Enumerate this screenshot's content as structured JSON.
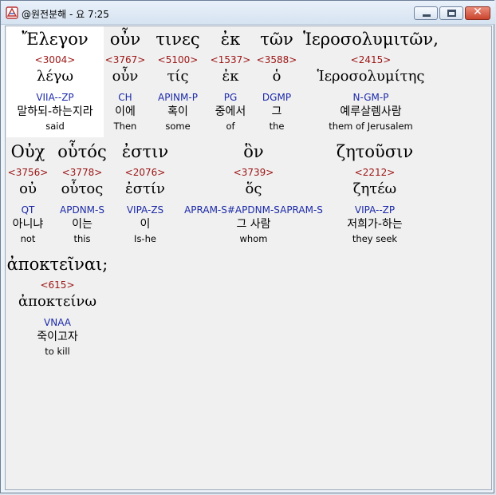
{
  "window": {
    "title": "@원전분해 - 요 7:25",
    "icon": "app-logo-icon"
  },
  "controls": {
    "minimize": "minimize-icon",
    "maximize": "maximize-icon",
    "close": "close-icon",
    "close_glyph": "✕"
  },
  "colors": {
    "number": "#9b1414",
    "parse": "#1c2aa8",
    "highlight": "#ffffff"
  },
  "rows": [
    [
      {
        "greek": "Ἔλεγον",
        "num": "<3004>",
        "lemma": "λέγω",
        "parse": "VIIA--ZP",
        "ko": "말하되-하는지라",
        "en": "said"
      },
      {
        "greek": "οὖν",
        "num": "<3767>",
        "lemma": "οὖν",
        "parse": "CH",
        "ko": "이에",
        "en": "Then"
      },
      {
        "greek": "τινες",
        "num": "<5100>",
        "lemma": "τίς",
        "parse": "APINM-P",
        "ko": "혹이",
        "en": "some"
      },
      {
        "greek": "ἐκ",
        "num": "<1537>",
        "lemma": "ἐκ",
        "parse": "PG",
        "ko": "중에서",
        "en": "of"
      },
      {
        "greek": "τῶν",
        "num": "<3588>",
        "lemma": "ὁ",
        "parse": "DGMP",
        "ko": "그",
        "en": "the"
      },
      {
        "greek": "Ἱεροσολυμιτῶν,",
        "num": "<2415>",
        "lemma": "Ἱεροσολυμίτης",
        "parse": "N-GM-P",
        "ko": "예루살렘사람",
        "en": "them of Jerusalem"
      }
    ],
    [
      {
        "greek": "Οὐχ",
        "num": "<3756>",
        "lemma": "οὐ",
        "parse": "QT",
        "ko": "아니냐",
        "en": "not"
      },
      {
        "greek": "οὗτός",
        "num": "<3778>",
        "lemma": "οὗτος",
        "parse": "APDNM-S",
        "ko": "이는",
        "en": "this"
      },
      {
        "greek": "ἐστιν",
        "num": "<2076>",
        "lemma": "ἐστίν",
        "parse": "VIPA-ZS",
        "ko": "이",
        "en": "Is-he"
      },
      {
        "greek": "ὃν",
        "num": "<3739>",
        "lemma": "ὅς",
        "parse": "APRAM-S#APDNM-SAPRAM-S",
        "ko": "그 사람",
        "en": "whom"
      },
      {
        "greek": "ζητοῦσιν",
        "num": "<2212>",
        "lemma": "ζητέω",
        "parse": "VIPA--ZP",
        "ko": "저희가-하는",
        "en": "they seek"
      }
    ],
    [
      {
        "greek": "ἀποκτεῖναι;",
        "num": "<615>",
        "lemma": "ἀποκτείνω",
        "parse": "VNAA",
        "ko": "죽이고자",
        "en": "to kill"
      }
    ]
  ]
}
